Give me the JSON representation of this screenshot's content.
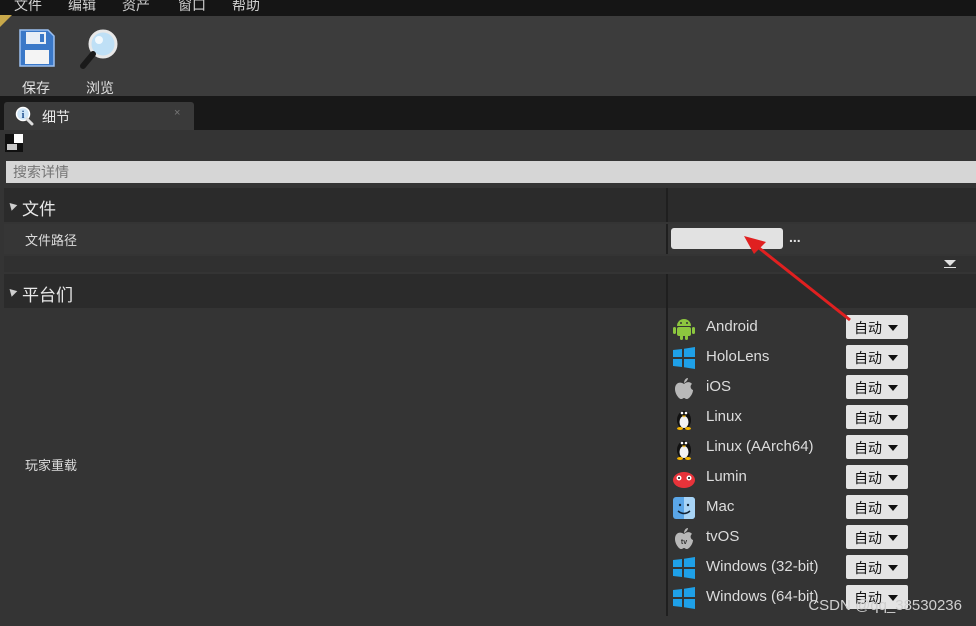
{
  "menu": [
    "文件",
    "编辑",
    "资产",
    "窗口",
    "帮助"
  ],
  "toolbar": {
    "save_label": "保存",
    "browse_label": "浏览"
  },
  "tab": {
    "label": "细节",
    "close": "×"
  },
  "search": {
    "placeholder": "搜索详情"
  },
  "sections": {
    "file": {
      "title": "文件",
      "path_label": "文件路径",
      "path_value": "",
      "more": "..."
    },
    "platforms": {
      "title": "平台们",
      "override_label": "玩家重载"
    }
  },
  "platforms": [
    {
      "name": "Android",
      "value": "自动",
      "icon": "android-icon"
    },
    {
      "name": "HoloLens",
      "value": "自动",
      "icon": "windows-icon"
    },
    {
      "name": "iOS",
      "value": "自动",
      "icon": "apple-icon"
    },
    {
      "name": "Linux",
      "value": "自动",
      "icon": "linux-icon"
    },
    {
      "name": "Linux (AArch64)",
      "value": "自动",
      "icon": "linux-icon"
    },
    {
      "name": "Lumin",
      "value": "自动",
      "icon": "lumin-icon"
    },
    {
      "name": "Mac",
      "value": "自动",
      "icon": "mac-icon"
    },
    {
      "name": "tvOS",
      "value": "自动",
      "icon": "tvos-icon"
    },
    {
      "name": "Windows (32-bit)",
      "value": "自动",
      "icon": "windows-icon"
    },
    {
      "name": "Windows (64-bit)",
      "value": "自动",
      "icon": "windows-icon"
    }
  ],
  "watermark": "CSDN @qq_38530236",
  "colors": {
    "annotation_arrow": "#e02020",
    "dropdown_bg": "#e4e4e4"
  }
}
